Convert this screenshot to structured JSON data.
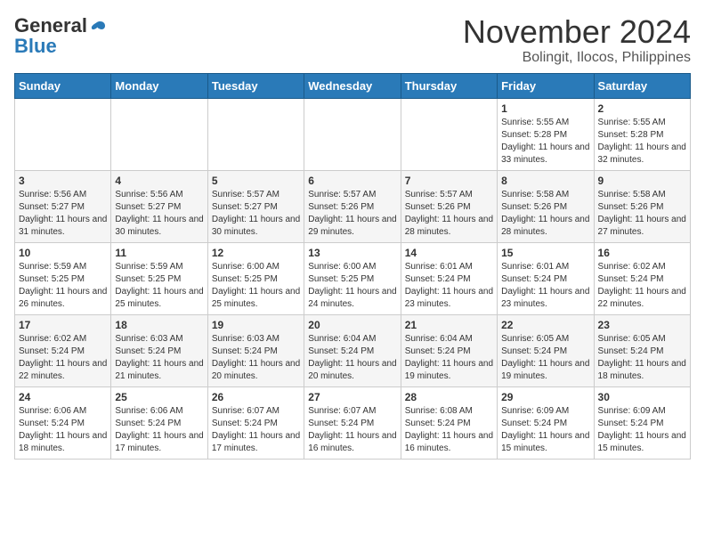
{
  "header": {
    "logo_general": "General",
    "logo_blue": "Blue",
    "title": "November 2024",
    "subtitle": "Bolingit, Ilocos, Philippines"
  },
  "weekdays": [
    "Sunday",
    "Monday",
    "Tuesday",
    "Wednesday",
    "Thursday",
    "Friday",
    "Saturday"
  ],
  "weeks": [
    [
      {
        "day": "",
        "sunrise": "",
        "sunset": "",
        "daylight": ""
      },
      {
        "day": "",
        "sunrise": "",
        "sunset": "",
        "daylight": ""
      },
      {
        "day": "",
        "sunrise": "",
        "sunset": "",
        "daylight": ""
      },
      {
        "day": "",
        "sunrise": "",
        "sunset": "",
        "daylight": ""
      },
      {
        "day": "",
        "sunrise": "",
        "sunset": "",
        "daylight": ""
      },
      {
        "day": "1",
        "sunrise": "Sunrise: 5:55 AM",
        "sunset": "Sunset: 5:28 PM",
        "daylight": "Daylight: 11 hours and 33 minutes."
      },
      {
        "day": "2",
        "sunrise": "Sunrise: 5:55 AM",
        "sunset": "Sunset: 5:28 PM",
        "daylight": "Daylight: 11 hours and 32 minutes."
      }
    ],
    [
      {
        "day": "3",
        "sunrise": "Sunrise: 5:56 AM",
        "sunset": "Sunset: 5:27 PM",
        "daylight": "Daylight: 11 hours and 31 minutes."
      },
      {
        "day": "4",
        "sunrise": "Sunrise: 5:56 AM",
        "sunset": "Sunset: 5:27 PM",
        "daylight": "Daylight: 11 hours and 30 minutes."
      },
      {
        "day": "5",
        "sunrise": "Sunrise: 5:57 AM",
        "sunset": "Sunset: 5:27 PM",
        "daylight": "Daylight: 11 hours and 30 minutes."
      },
      {
        "day": "6",
        "sunrise": "Sunrise: 5:57 AM",
        "sunset": "Sunset: 5:26 PM",
        "daylight": "Daylight: 11 hours and 29 minutes."
      },
      {
        "day": "7",
        "sunrise": "Sunrise: 5:57 AM",
        "sunset": "Sunset: 5:26 PM",
        "daylight": "Daylight: 11 hours and 28 minutes."
      },
      {
        "day": "8",
        "sunrise": "Sunrise: 5:58 AM",
        "sunset": "Sunset: 5:26 PM",
        "daylight": "Daylight: 11 hours and 28 minutes."
      },
      {
        "day": "9",
        "sunrise": "Sunrise: 5:58 AM",
        "sunset": "Sunset: 5:26 PM",
        "daylight": "Daylight: 11 hours and 27 minutes."
      }
    ],
    [
      {
        "day": "10",
        "sunrise": "Sunrise: 5:59 AM",
        "sunset": "Sunset: 5:25 PM",
        "daylight": "Daylight: 11 hours and 26 minutes."
      },
      {
        "day": "11",
        "sunrise": "Sunrise: 5:59 AM",
        "sunset": "Sunset: 5:25 PM",
        "daylight": "Daylight: 11 hours and 25 minutes."
      },
      {
        "day": "12",
        "sunrise": "Sunrise: 6:00 AM",
        "sunset": "Sunset: 5:25 PM",
        "daylight": "Daylight: 11 hours and 25 minutes."
      },
      {
        "day": "13",
        "sunrise": "Sunrise: 6:00 AM",
        "sunset": "Sunset: 5:25 PM",
        "daylight": "Daylight: 11 hours and 24 minutes."
      },
      {
        "day": "14",
        "sunrise": "Sunrise: 6:01 AM",
        "sunset": "Sunset: 5:24 PM",
        "daylight": "Daylight: 11 hours and 23 minutes."
      },
      {
        "day": "15",
        "sunrise": "Sunrise: 6:01 AM",
        "sunset": "Sunset: 5:24 PM",
        "daylight": "Daylight: 11 hours and 23 minutes."
      },
      {
        "day": "16",
        "sunrise": "Sunrise: 6:02 AM",
        "sunset": "Sunset: 5:24 PM",
        "daylight": "Daylight: 11 hours and 22 minutes."
      }
    ],
    [
      {
        "day": "17",
        "sunrise": "Sunrise: 6:02 AM",
        "sunset": "Sunset: 5:24 PM",
        "daylight": "Daylight: 11 hours and 22 minutes."
      },
      {
        "day": "18",
        "sunrise": "Sunrise: 6:03 AM",
        "sunset": "Sunset: 5:24 PM",
        "daylight": "Daylight: 11 hours and 21 minutes."
      },
      {
        "day": "19",
        "sunrise": "Sunrise: 6:03 AM",
        "sunset": "Sunset: 5:24 PM",
        "daylight": "Daylight: 11 hours and 20 minutes."
      },
      {
        "day": "20",
        "sunrise": "Sunrise: 6:04 AM",
        "sunset": "Sunset: 5:24 PM",
        "daylight": "Daylight: 11 hours and 20 minutes."
      },
      {
        "day": "21",
        "sunrise": "Sunrise: 6:04 AM",
        "sunset": "Sunset: 5:24 PM",
        "daylight": "Daylight: 11 hours and 19 minutes."
      },
      {
        "day": "22",
        "sunrise": "Sunrise: 6:05 AM",
        "sunset": "Sunset: 5:24 PM",
        "daylight": "Daylight: 11 hours and 19 minutes."
      },
      {
        "day": "23",
        "sunrise": "Sunrise: 6:05 AM",
        "sunset": "Sunset: 5:24 PM",
        "daylight": "Daylight: 11 hours and 18 minutes."
      }
    ],
    [
      {
        "day": "24",
        "sunrise": "Sunrise: 6:06 AM",
        "sunset": "Sunset: 5:24 PM",
        "daylight": "Daylight: 11 hours and 18 minutes."
      },
      {
        "day": "25",
        "sunrise": "Sunrise: 6:06 AM",
        "sunset": "Sunset: 5:24 PM",
        "daylight": "Daylight: 11 hours and 17 minutes."
      },
      {
        "day": "26",
        "sunrise": "Sunrise: 6:07 AM",
        "sunset": "Sunset: 5:24 PM",
        "daylight": "Daylight: 11 hours and 17 minutes."
      },
      {
        "day": "27",
        "sunrise": "Sunrise: 6:07 AM",
        "sunset": "Sunset: 5:24 PM",
        "daylight": "Daylight: 11 hours and 16 minutes."
      },
      {
        "day": "28",
        "sunrise": "Sunrise: 6:08 AM",
        "sunset": "Sunset: 5:24 PM",
        "daylight": "Daylight: 11 hours and 16 minutes."
      },
      {
        "day": "29",
        "sunrise": "Sunrise: 6:09 AM",
        "sunset": "Sunset: 5:24 PM",
        "daylight": "Daylight: 11 hours and 15 minutes."
      },
      {
        "day": "30",
        "sunrise": "Sunrise: 6:09 AM",
        "sunset": "Sunset: 5:24 PM",
        "daylight": "Daylight: 11 hours and 15 minutes."
      }
    ]
  ]
}
